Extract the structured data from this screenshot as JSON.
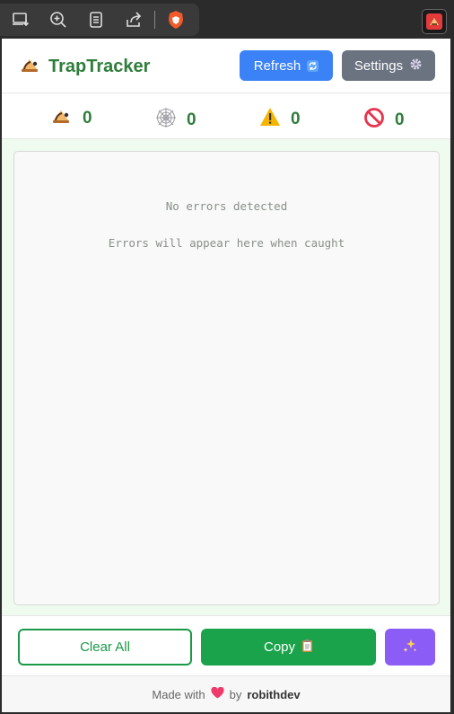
{
  "header": {
    "title": "TrapTracker",
    "refresh_label": "Refresh",
    "settings_label": "Settings"
  },
  "stats": [
    {
      "icon": "mousetrap-icon",
      "value": "0"
    },
    {
      "icon": "spiderweb-icon",
      "value": "0"
    },
    {
      "icon": "warning-icon",
      "value": "0"
    },
    {
      "icon": "prohibited-icon",
      "value": "0"
    }
  ],
  "errors": {
    "empty_title": "No errors detected",
    "empty_hint": "Errors will appear here when caught"
  },
  "actions": {
    "clear_label": "Clear All",
    "copy_label": "Copy"
  },
  "credits": {
    "made_with": "Made with",
    "by": "by",
    "author": "robithdev"
  },
  "colors": {
    "brand_green": "#2f7d3b",
    "refresh_blue": "#3b82f6",
    "settings_gray": "#6b7280",
    "copy_green": "#1aa34a",
    "magic_purple": "#8b5cf6"
  }
}
